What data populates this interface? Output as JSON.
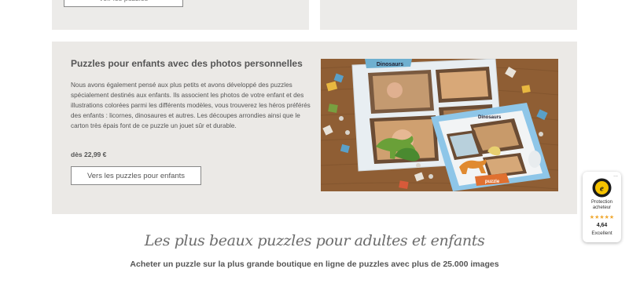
{
  "top_cards": {
    "left_button_label": "Voir les puzzles"
  },
  "panel": {
    "title": "Puzzles pour enfants avec des photos personnelles",
    "description": "Nous avons également pensé aux plus petits et avons développé des puzzles spécialement destinés aux enfants. Ils associent les photos de votre enfant et des illustrations colorées parmi les différents modèles, vous trouverez les héros préférés des enfants : licornes, dinosaures et autres. Les découpes arrondies ainsi que le carton très épais font de ce puzzle un jouet sûr et durable.",
    "price": "dès 22,99 €",
    "button_label": "Vers les puzzles pour enfants",
    "image": {
      "puzzle1_title": "Dinosaurs",
      "puzzle2_title": "Dinosaurs",
      "brand_mark": "puzzle"
    }
  },
  "section": {
    "heading": "Les plus beaux puzzles pour adultes et enfants",
    "subheading": "Acheter un puzzle sur la plus grande boutique en ligne de puzzles avec plus de 25.000 images"
  },
  "trust_badge": {
    "label": "Protection acheteur",
    "stars": "★★★★★",
    "score": "4,64",
    "rating_text": "Excellent",
    "dots": "..."
  },
  "colors": {
    "panel_bg": "#ebe9e6",
    "wood": "#8a5a32",
    "sky_blue": "#8ec6e8",
    "star": "#f0a830"
  }
}
